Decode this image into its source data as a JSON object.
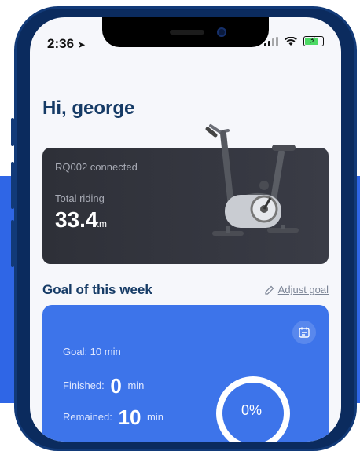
{
  "status_bar": {
    "time": "2:36",
    "location_icon": "location-arrow-icon",
    "wifi_icon": "wifi-icon",
    "battery_icon": "battery-charging-icon"
  },
  "greeting": "Hi, george",
  "device": {
    "connected_text": "RQ002 connected",
    "total_label": "Total riding",
    "total_value": "33.4",
    "total_unit": "km",
    "image_icon": "exercise-bike-icon"
  },
  "goal": {
    "title": "Goal of this week",
    "adjust_label": "Adjust goal",
    "goal_label": "Goal: 10 min",
    "finished_label": "Finished:",
    "finished_value": "0",
    "finished_unit": "min",
    "remained_label": "Remained:",
    "remained_value": "10",
    "remained_unit": "min",
    "progress_text": "0%",
    "progress_fraction": 0.0
  },
  "colors": {
    "primary_blue": "#3d74ea",
    "title_navy": "#163b66",
    "device_card": "#2e3038"
  }
}
